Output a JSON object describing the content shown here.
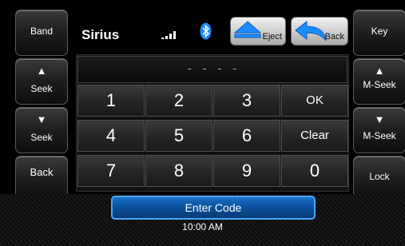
{
  "left_panel": {
    "band_label": "Band",
    "seek_up_label": "Seek",
    "seek_down_label": "Seek",
    "back_label": "Back"
  },
  "right_panel": {
    "key_label": "Key",
    "mseek_up_label": "M-Seek",
    "mseek_down_label": "M-Seek",
    "lock_label": "Lock"
  },
  "header": {
    "source": "Sirius",
    "eject_label": "Eject",
    "back_label": "Back",
    "bluetooth_icon": "bluetooth-icon",
    "signal_icon": "signal-bars-icon",
    "accent_color": "#1c8cff"
  },
  "keypad": {
    "display": "- - - -",
    "keys": [
      "1",
      "2",
      "3",
      "OK",
      "4",
      "5",
      "6",
      "Clear",
      "7",
      "8",
      "9",
      "0"
    ]
  },
  "footer": {
    "enter_code_label": "Enter Code",
    "time": "10:00 AM"
  }
}
